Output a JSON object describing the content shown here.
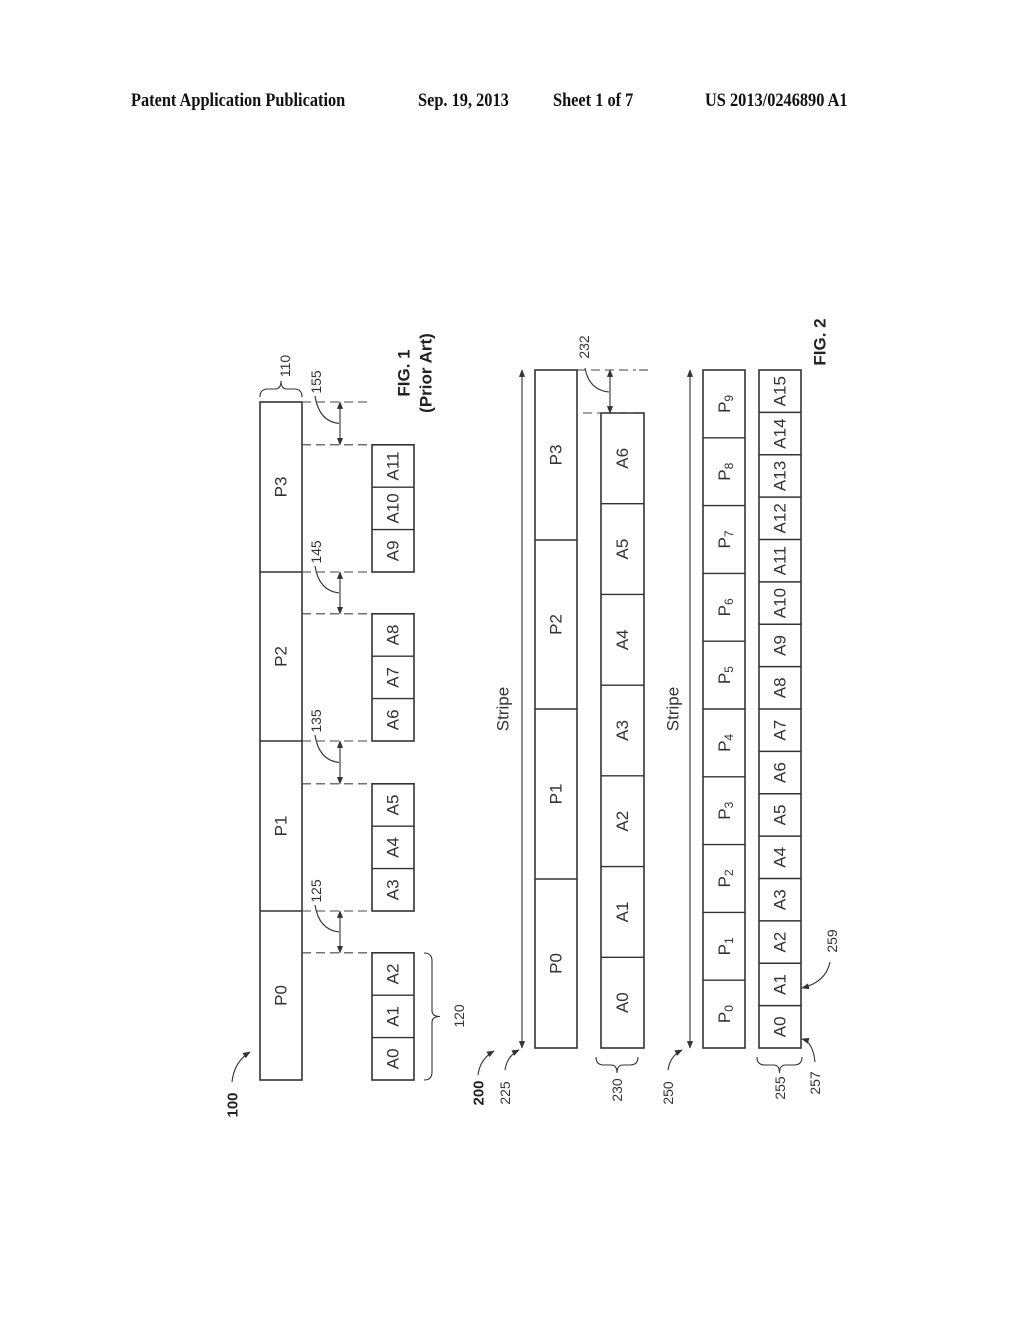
{
  "header": {
    "publication": "Patent Application Publication",
    "date": "Sep. 19, 2013",
    "sheet": "Sheet 1 of 7",
    "number": "US 2013/0246890 A1"
  },
  "fig1": {
    "ref_figure": "100",
    "ref_parity_bar": "110",
    "ref_data_group": "120",
    "parity_blocks": [
      "P0",
      "P1",
      "P2",
      "P3"
    ],
    "data_groups": [
      [
        "A0",
        "A1",
        "A2"
      ],
      [
        "A3",
        "A4",
        "A5"
      ],
      [
        "A6",
        "A7",
        "A8"
      ],
      [
        "A9",
        "A10",
        "A11"
      ]
    ],
    "gap_refs": [
      "125",
      "135",
      "145",
      "155"
    ],
    "caption": "FIG. 1",
    "caption_sub": "(Prior Art)"
  },
  "fig2": {
    "ref_figure": "200",
    "caption": "FIG. 2",
    "top": {
      "ref_stripe": "225",
      "stripe_label": "Stripe",
      "parity_blocks": [
        "P0",
        "P1",
        "P2",
        "P3"
      ],
      "ref_data_bar": "230",
      "data_blocks": [
        "A0",
        "A1",
        "A2",
        "A3",
        "A4",
        "A5",
        "A6"
      ],
      "ref_gap": "232"
    },
    "bottom": {
      "ref_stripe": "250",
      "stripe_label": "Stripe",
      "parity_blocks": [
        {
          "base": "P",
          "sub": "0"
        },
        {
          "base": "P",
          "sub": "1"
        },
        {
          "base": "P",
          "sub": "2"
        },
        {
          "base": "P",
          "sub": "3"
        },
        {
          "base": "P",
          "sub": "4"
        },
        {
          "base": "P",
          "sub": "5"
        },
        {
          "base": "P",
          "sub": "6"
        },
        {
          "base": "P",
          "sub": "7"
        },
        {
          "base": "P",
          "sub": "8"
        },
        {
          "base": "P",
          "sub": "9"
        }
      ],
      "ref_data_bar": "255",
      "data_blocks": [
        "A0",
        "A1",
        "A2",
        "A3",
        "A4",
        "A5",
        "A6",
        "A7",
        "A8",
        "A9",
        "A10",
        "A11",
        "A12",
        "A13",
        "A14",
        "A15"
      ],
      "ref_boundary_1": "257",
      "ref_boundary_2": "259"
    }
  }
}
